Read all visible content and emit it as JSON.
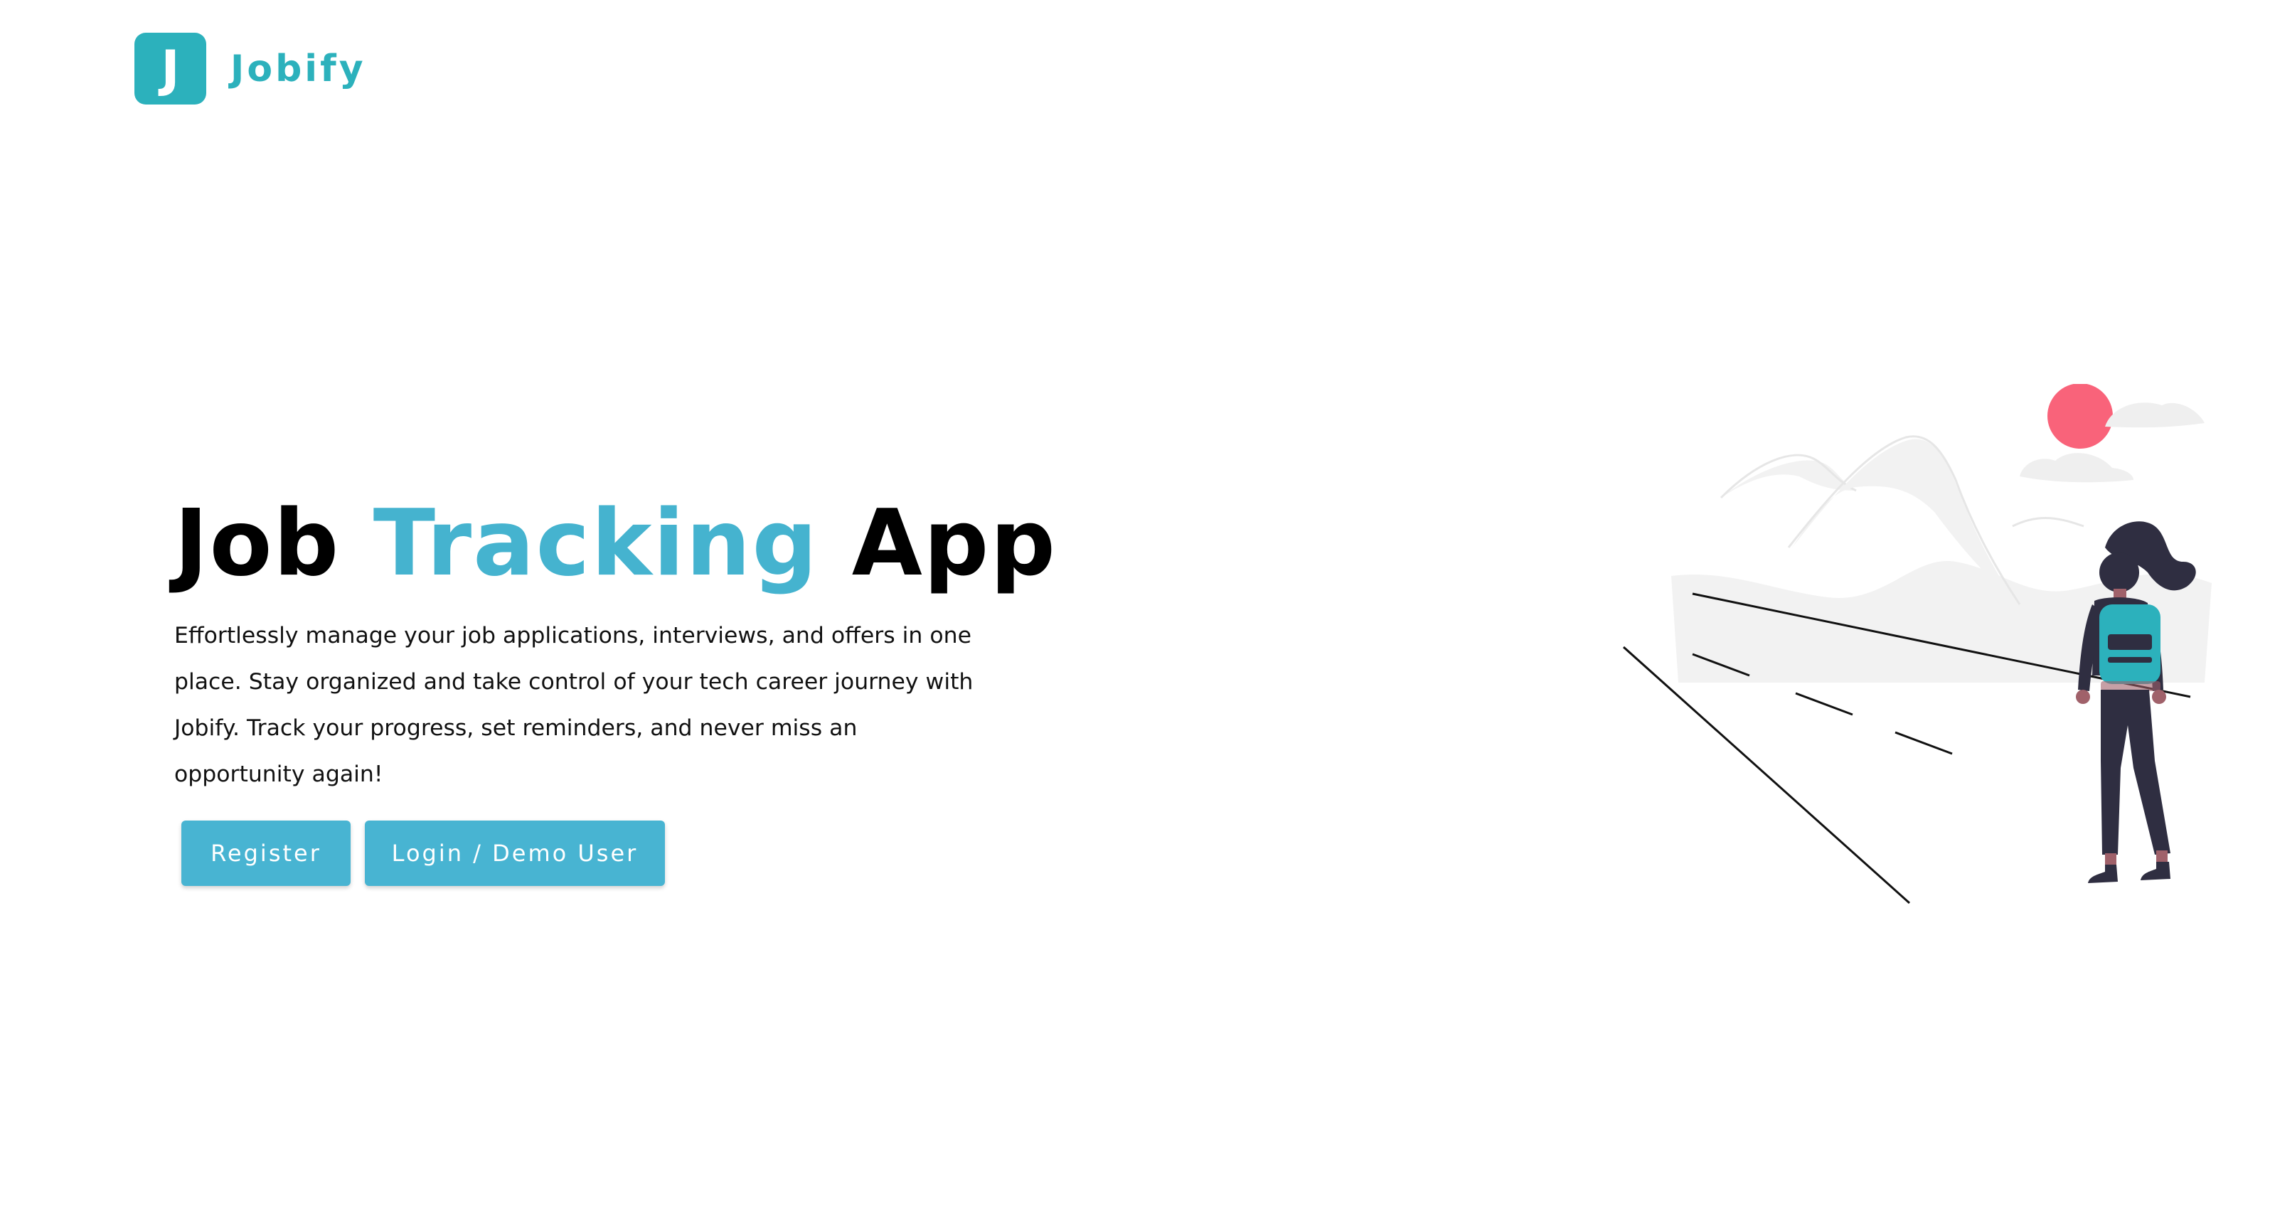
{
  "brand": {
    "logo_letter": "J",
    "name": "Jobify"
  },
  "hero": {
    "title_part1": "Job ",
    "title_accent": "Tracking",
    "title_part2": " App",
    "description": "Effortlessly manage your job applications, interviews, and offers in one place. Stay organized and take control of your tech career journey with Jobify. Track your progress, set reminders, and never miss an opportunity again!"
  },
  "buttons": {
    "register_label": "Register",
    "login_label": "Login / Demo User"
  },
  "colors": {
    "brand": "#2cb1bc",
    "accent": "#45b3cf",
    "button": "#48b4d2",
    "sun": "#f9637a",
    "figure_dark": "#2f2e41",
    "backpack": "#2cb1bc"
  },
  "icons": {
    "illustration": "hiker-mountains-illustration"
  }
}
